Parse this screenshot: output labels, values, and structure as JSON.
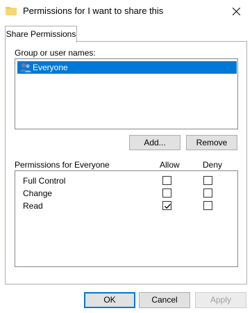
{
  "window": {
    "title": "Permissions for I want to share this",
    "folder_icon": "folder-icon",
    "close_icon": "close-icon"
  },
  "tabs": [
    {
      "label": "Share Permissions",
      "selected": true
    }
  ],
  "group": {
    "label": "Group or user names:",
    "items": [
      {
        "label": "Everyone",
        "icon": "users-icon",
        "selected": true
      }
    ]
  },
  "actions": {
    "add_label": "Add...",
    "remove_label": "Remove"
  },
  "permissions": {
    "header": "Permissions for Everyone",
    "allow_header": "Allow",
    "deny_header": "Deny",
    "rows": [
      {
        "name": "Full Control",
        "allow": false,
        "deny": false
      },
      {
        "name": "Change",
        "allow": false,
        "deny": false
      },
      {
        "name": "Read",
        "allow": true,
        "deny": false
      }
    ]
  },
  "footer": {
    "ok_label": "OK",
    "cancel_label": "Cancel",
    "apply_label": "Apply"
  },
  "colors": {
    "accent": "#0078d7",
    "selection_text": "#ffffff"
  }
}
